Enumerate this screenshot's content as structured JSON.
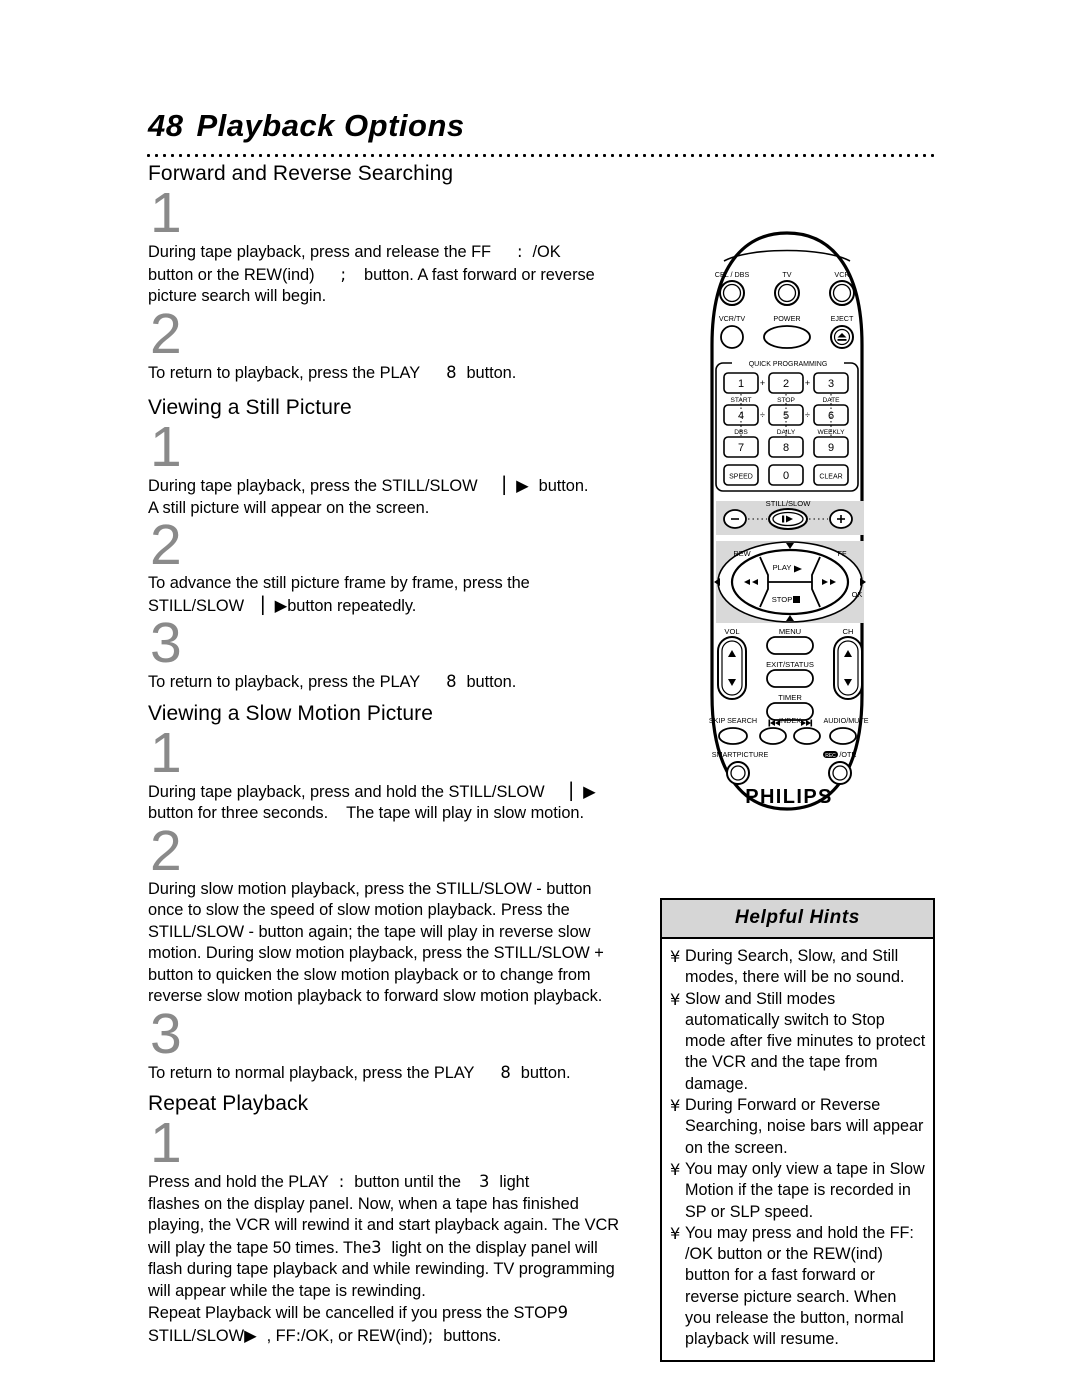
{
  "page": {
    "number": "48",
    "title": "Playback Options"
  },
  "sections": [
    {
      "heading": "Forward and Reverse Searching",
      "steps": [
        {
          "num": "1",
          "lines": [
            "During tape playback, press and release the FF",
            "button or the REW(ind)",
            "picture search will begin."
          ],
          "text_a": "During tape playback, press and release the FF",
          "sym_a": ":",
          "text_b": "/OK",
          "text_c": "button or the REW(ind)",
          "sym_b": ";",
          "text_d": "button.  A fast forward or reverse",
          "text_e": "picture search will begin."
        },
        {
          "num": "2",
          "text_a": "To return to playback, press the PLAY",
          "sym_a": "8",
          "text_b": "button."
        }
      ]
    },
    {
      "heading": "Viewing a Still Picture",
      "steps": [
        {
          "num": "1",
          "text_a": "During tape playback, press the STILL/SLOW",
          "sym_a": "▏▶",
          "text_b": "button.",
          "text_c": "A still picture will appear on the screen."
        },
        {
          "num": "2",
          "text_a": "To advance the still picture frame by frame, press the",
          "text_b": "STILL/SLOW",
          "sym_a": "▏▶",
          "text_c": "button repeatedly."
        },
        {
          "num": "3",
          "text_a": "To return to playback, press the PLAY",
          "sym_a": "8",
          "text_b": "button."
        }
      ]
    },
    {
      "heading": "Viewing a Slow Motion Picture",
      "steps": [
        {
          "num": "1",
          "text_a": "During tape playback, press and hold the STILL/SLOW",
          "sym_a": "▏▶",
          "text_b": "button for three seconds.",
          "text_c": "The tape will play in slow motion."
        },
        {
          "num": "2",
          "text_a": "During slow motion playback, press the STILL/SLOW - button",
          "text_b": "once to slow the speed of slow motion playback. Press the",
          "text_c": "STILL/SLOW - button again; the tape will play in reverse slow",
          "text_d": "motion. During slow motion playback, press the STILL/SLOW +",
          "text_e": "button to quicken the slow motion playback or to change from",
          "text_f": "reverse slow motion playback to forward slow motion playback."
        },
        {
          "num": "3",
          "text_a": "To return to normal playback, press the PLAY",
          "sym_a": "8",
          "text_b": "button."
        }
      ]
    },
    {
      "heading": "Repeat Playback",
      "steps": [
        {
          "num": "1",
          "text_a": "Press and hold the PLAY",
          "sym_a": ":",
          "text_b": "button until the",
          "sym_b": "3",
          "text_c": "light",
          "text_d": "flashes on the display panel.  Now, when a tape has finished",
          "text_e": "playing, the VCR will rewind it and start playback again. The VCR",
          "text_f": "will play the tape 50 times. The",
          "sym_c": "3",
          "text_g": "light on the display panel will",
          "text_h": "flash during tape playback and while rewinding. TV programming",
          "text_i": "will appear while the tape is rewinding.",
          "text_j": "Repeat Playback will be cancelled if you press the STOP",
          "sym_d": "9",
          "text_k": "STILL/SLOW",
          "sym_e": "▶",
          "text_l": ", FF",
          "sym_f": ":",
          "text_m": "/OK, or REW(ind)",
          "sym_g": ";",
          "text_n": "buttons."
        }
      ]
    }
  ],
  "hints": {
    "title": "Helpful Hints",
    "bullet": "¥",
    "items": [
      "During Search, Slow, and Still modes, there will be no sound.",
      "Slow and Still modes automatically switch to Stop mode after five minutes to protect the VCR and the tape from damage.",
      "During Forward or Reverse Searching, noise bars will appear on the screen.",
      "You may only view a tape in Slow Motion if the tape is recorded in SP or SLP speed.",
      "You may press and hold the FF: /OK button or the REW(ind)  button for a fast forward or reverse picture search. When you release the button, normal playback will resume."
    ]
  },
  "remote": {
    "brand": "PHILIPS",
    "top_buttons": [
      "CBL / DBS",
      "TV",
      "VCR"
    ],
    "second_row": [
      "VCR/TV",
      "POWER",
      "EJECT"
    ],
    "eject_icon": "eject-triangle",
    "keypad_label": "QUICK PROGRAMMING",
    "keypad_keys": [
      "1",
      "2",
      "3",
      "4",
      "5",
      "6",
      "7",
      "8",
      "9",
      "SPEED",
      "0",
      "CLEAR"
    ],
    "keypad_sublabels_row1": [
      "START",
      "STOP",
      "DATE"
    ],
    "keypad_sublabels_row2": [
      "DBS",
      "DAILY",
      "WEEKLY"
    ],
    "keypad_signs": [
      "+",
      "+",
      "÷",
      "÷"
    ],
    "still_slow_label": "STILL/SLOW",
    "still_slow_minus": "−",
    "still_slow_plus": "+",
    "still_slow_center": "▏▶",
    "dpad": {
      "rew_label": "REW",
      "ff_label": "FF",
      "play_label": "PLAY",
      "play_icon": "▶",
      "stop_label": "STOP",
      "stop_icon": "■",
      "rew_icon": "◀◀",
      "ff_icon": "▶▶",
      "ok_label": "OK",
      "up_icon": "▲",
      "down_icon": "▼",
      "left_icon": "◀",
      "right_icon": "▶"
    },
    "vol_label": "VOL",
    "ch_label": "CH",
    "menu_label": "MENU",
    "exit_status_label": "EXIT/STATUS",
    "timer_label": "TIMER",
    "bottom_row": [
      "SKIP SEARCH",
      "INDEX",
      "AUDIO/MUTE"
    ],
    "index_prev_icon": "⏮",
    "index_next_icon": "⏭",
    "smart_picture_label": "SMARTPICTURE",
    "rec_otr_label": "/OTR",
    "rec_badge": "REC",
    "up_arrow": "▲",
    "down_arrow": "▼"
  },
  "colors": {
    "step_number": "#8a8a8a",
    "hints_header_bg": "#d6d6d6",
    "remote_panel_bg": "#d9d9d9",
    "ink": "#000000"
  }
}
